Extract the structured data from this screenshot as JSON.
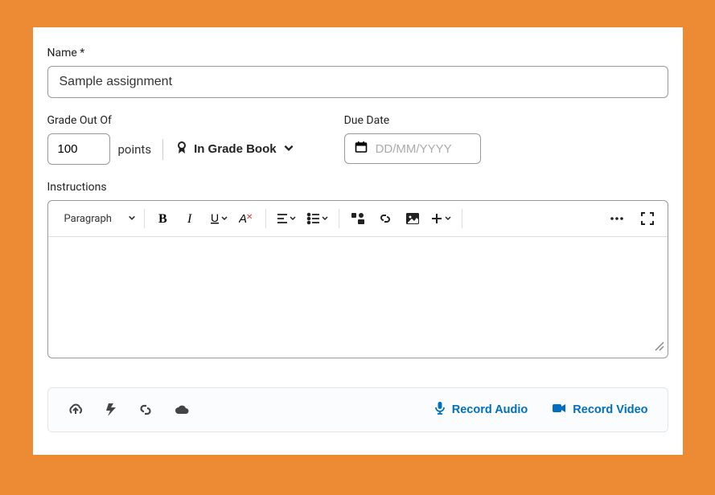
{
  "labels": {
    "name": "Name *",
    "gradeOutOf": "Grade Out Of",
    "dueDate": "Due Date",
    "instructions": "Instructions",
    "points": "points",
    "inGradeBook": "In Grade Book",
    "paragraph": "Paragraph"
  },
  "values": {
    "name": "Sample assignment",
    "grade": "100",
    "dueDate": "",
    "dueDatePlaceholder": "DD/MM/YYYY"
  },
  "attach": {
    "recordAudio": "Record Audio",
    "recordVideo": "Record Video"
  }
}
